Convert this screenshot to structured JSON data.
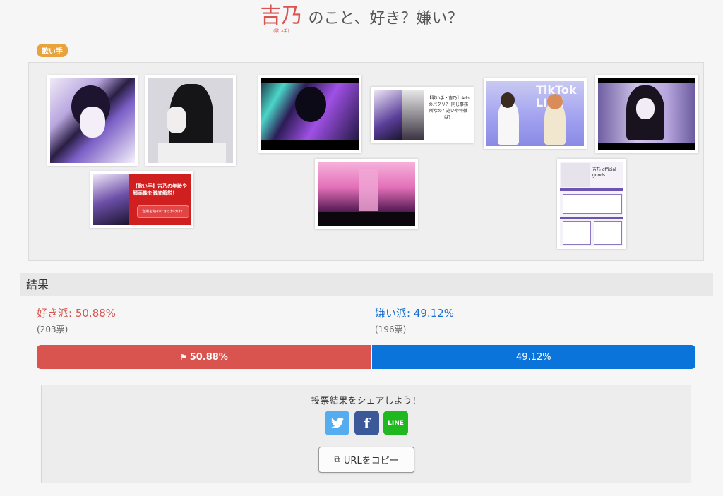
{
  "header": {
    "name": "吉乃",
    "ruby": "(歌い手)",
    "question": "のこと、好き？嫌い？"
  },
  "category_tag": "歌い手",
  "gallery": {
    "thumb3_caption": "【歌い手】吉乃の年齢や顔画像を徹底解説！",
    "thumb3_button": "音楽を始めたきっかけは？",
    "thumb5_caption": "【歌い手・吉乃】Adoのパクリ？ 同じ事務所なの？違いや特徴は？",
    "thumb6_overlay": "TikTok LIVE",
    "thumb8_caption": "吉乃 official goods"
  },
  "results": {
    "header": "結果",
    "like_label": "好き派",
    "like_percent": "50.88%",
    "like_votes": "(203票)",
    "dislike_label": "嫌い派",
    "dislike_percent": "49.12%",
    "dislike_votes": "(196票)",
    "like_fraction": 0.5088,
    "dislike_fraction": 0.4912,
    "like_bar_label": "50.88%",
    "dislike_bar_label": "49.12%"
  },
  "share": {
    "prompt": "投票結果をシェアしよう！",
    "twitter": "twitter-icon",
    "facebook_glyph": "f",
    "line_label": "LINE",
    "copy_label": "URLをコピー"
  },
  "colors": {
    "like": "#d9534f",
    "dislike": "#0a74da",
    "tag": "#e8a33d"
  }
}
